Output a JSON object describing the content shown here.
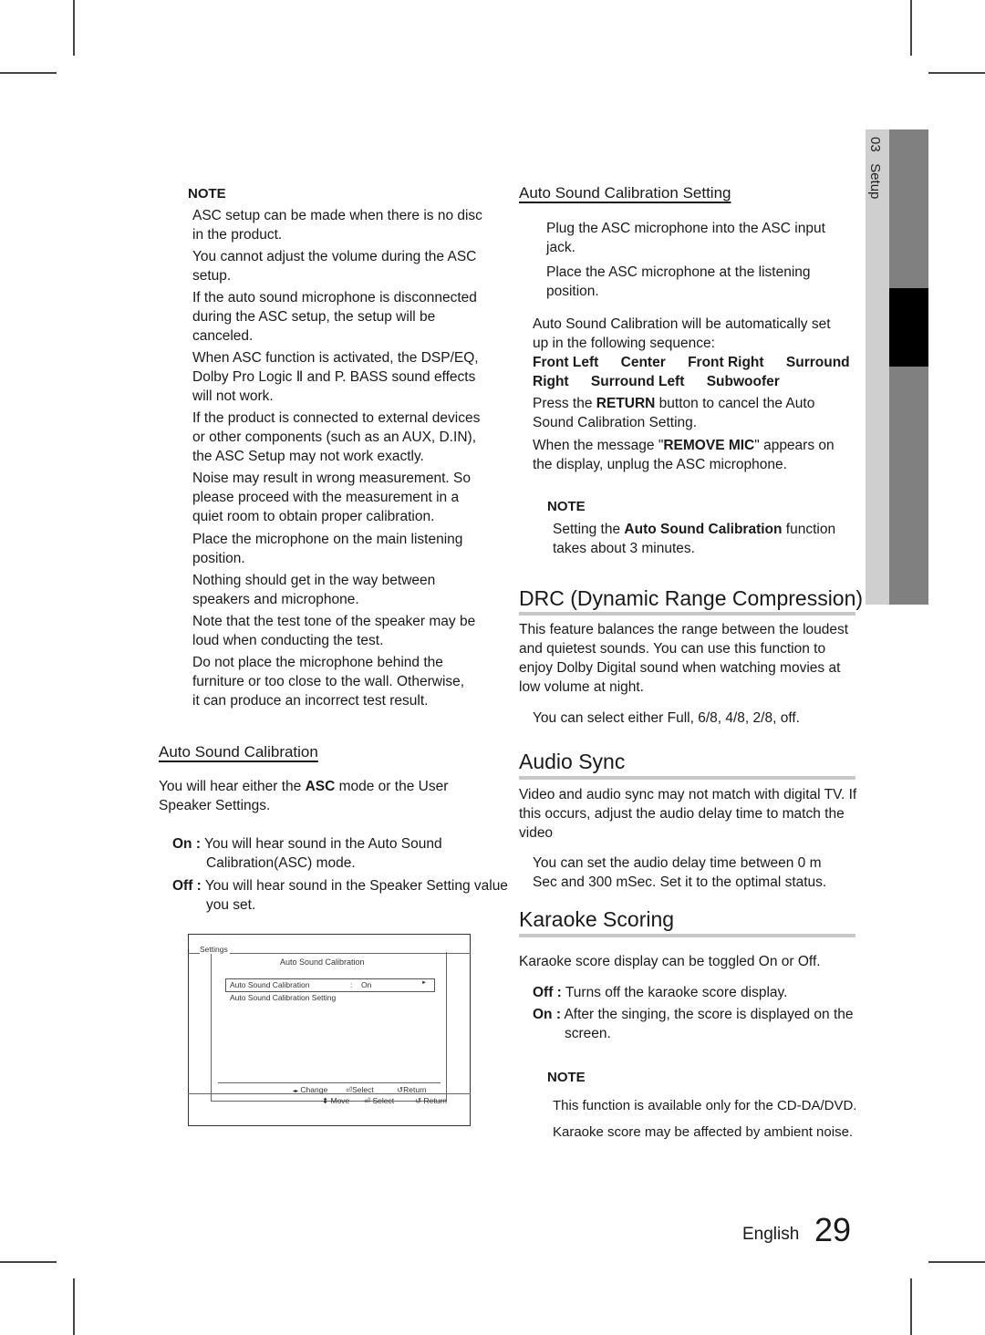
{
  "side_tab": {
    "chapter": "03",
    "title": "Setup"
  },
  "left": {
    "note_heading": "NOTE",
    "notes": [
      "ASC setup can be made when there is no disc in the product.",
      "You cannot adjust the volume during the ASC setup.",
      "If the auto sound microphone is disconnected during the ASC setup, the setup will be canceled.",
      "When ASC function is activated, the DSP/EQ, Dolby Pro Logic Ⅱ and P. BASS sound effects will not work.",
      "If the product is connected to external devices or other components (such as an AUX, D.IN), the ASC Setup may not work exactly.",
      "Noise may result in wrong measurement. So please proceed with the measurement in a quiet room to obtain proper calibration.",
      "Place the microphone on the main listening position.",
      "Nothing should get in the way between speakers and microphone.",
      "Note that the test tone of the speaker may be loud when conducting the test.",
      "Do not place the microphone behind the furniture or too close to the wall. Otherwise, it can produce an incorrect test result."
    ],
    "asc": {
      "heading": "Auto Sound Calibration",
      "intro_pre": "You will hear either the ",
      "intro_bold": "ASC",
      "intro_post": " mode or the User Speaker Settings.",
      "options": [
        {
          "label": "On :",
          "text": "You will hear sound in the Auto Sound Calibration(ASC) mode."
        },
        {
          "label": "Off :",
          "text": "You will hear sound in the Speaker Setting value you set."
        }
      ]
    },
    "screen": {
      "settings_label": "Settings",
      "title": "Auto Sound Calibration",
      "rows": [
        {
          "label": "Auto Sound Calibration",
          "sep": ":",
          "value": "On",
          "arrow": "►"
        },
        {
          "label": "Auto Sound Calibration Setting"
        }
      ],
      "footer1": [
        {
          "icon": "left-right-arrows-icon",
          "glyph": "◂▸",
          "label": "Change"
        },
        {
          "icon": "enter-icon",
          "glyph": "⏎",
          "label": "Select"
        },
        {
          "icon": "return-icon",
          "glyph": "↺",
          "label": "Return"
        }
      ],
      "footer2": [
        {
          "icon": "up-down-arrows-icon",
          "glyph": "⬍",
          "label": "Move"
        },
        {
          "icon": "enter-icon",
          "glyph": "⏎",
          "label": "Select"
        },
        {
          "icon": "return-icon",
          "glyph": "↺",
          "label": "Return"
        }
      ]
    }
  },
  "right": {
    "asc_setting": {
      "heading": "Auto Sound Calibration Setting",
      "steps": [
        "Plug the ASC microphone into the ASC input jack.",
        "Place the ASC microphone at the listening position."
      ],
      "sequence_intro": "Auto Sound Calibration will be automatically set up in the following sequence:",
      "sequence_line1": [
        "Front Left",
        "Center",
        "Front Right",
        "Surround"
      ],
      "sequence_line2": [
        "Right",
        "Surround Left",
        "Subwoofer"
      ],
      "return_pre": "Press the ",
      "return_bold": "RETURN",
      "return_post": " button to cancel the Auto Sound Calibration Setting.",
      "mic_pre": "When the message \"",
      "mic_bold": "REMOVE MIC",
      "mic_post": "\" appears on the display, unplug the ASC microphone.",
      "note_heading": "NOTE",
      "note_pre": "Setting the ",
      "note_bold": "Auto Sound Calibration",
      "note_post": " function takes about 3 minutes."
    },
    "drc": {
      "heading": "DRC (Dynamic Range Compression)",
      "body": "This feature balances the range between the loudest and quietest sounds. You can use this function to enjoy Dolby Digital sound when watching movies at low volume at night.",
      "bullet": "You can select either Full, 6/8, 4/8, 2/8, off."
    },
    "audio_sync": {
      "heading": "Audio Sync",
      "body": "Video and audio sync may not match with digital TV. If this occurs, adjust the audio delay time to match the video",
      "bullet": "You can set the audio delay time between 0 m Sec and 300 mSec. Set it to the optimal status."
    },
    "karaoke": {
      "heading": "Karaoke Scoring",
      "body": "Karaoke score display can be toggled On or Off.",
      "options": [
        {
          "label": "Off :",
          "text": "Turns off the karaoke score display."
        },
        {
          "label": "On :",
          "text": "After the singing, the score is displayed on the screen."
        }
      ],
      "note_heading": "NOTE",
      "notes": [
        "This function is available only for the CD-DA/DVD.",
        "Karaoke score may be affected by ambient noise."
      ]
    }
  },
  "footer": {
    "language": "English",
    "page_number": "29"
  }
}
